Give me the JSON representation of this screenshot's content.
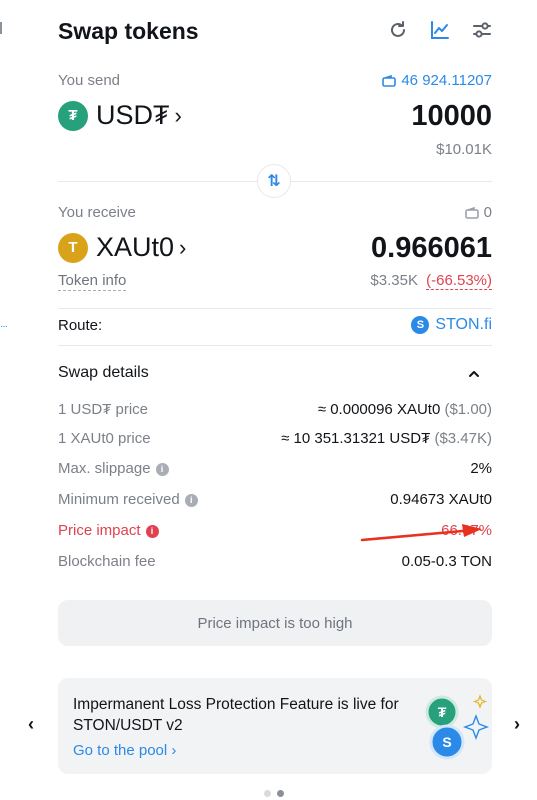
{
  "header": {
    "title": "Swap tokens",
    "icons": [
      "refresh-icon",
      "chart-icon",
      "settings-sliders-icon"
    ]
  },
  "send": {
    "label": "You send",
    "balance": "46 924.11207",
    "token": "USD₮",
    "amount": "10000",
    "usd_value": "$10.01K",
    "logo_color": "#26a17b"
  },
  "receive": {
    "label": "You receive",
    "balance": "0",
    "token": "XAUt0",
    "amount": "0.966061",
    "usd_value": "$3.35K",
    "change": "(-66.53%)",
    "token_info": "Token info",
    "logo_color": "#d9a21b"
  },
  "route": {
    "label": "Route:",
    "provider": "STON.fi"
  },
  "details": {
    "title": "Swap details",
    "rows": [
      {
        "key": "1 USD₮ price",
        "value": "≈ 0.000096 XAUt0",
        "extra": "($1.00)"
      },
      {
        "key": "1 XAUt0 price",
        "value": "≈ 10 351.31321 USD₮",
        "extra": "($3.47K)"
      },
      {
        "key": "Max. slippage",
        "value": "2%"
      },
      {
        "key": "Minimum received",
        "value": "0.94673 XAUt0"
      },
      {
        "key": "Price impact",
        "value": "66.07%"
      },
      {
        "key": "Blockchain fee",
        "value": "0.05-0.3 TON"
      }
    ]
  },
  "cta": {
    "label": "Price impact is too high"
  },
  "promo": {
    "text": "Impermanent Loss Protection Feature is live for STON/USDT v2",
    "link": "Go to the pool"
  },
  "colors": {
    "accent": "#2b8ae8",
    "danger": "#e0424f",
    "muted": "#7b8089"
  }
}
